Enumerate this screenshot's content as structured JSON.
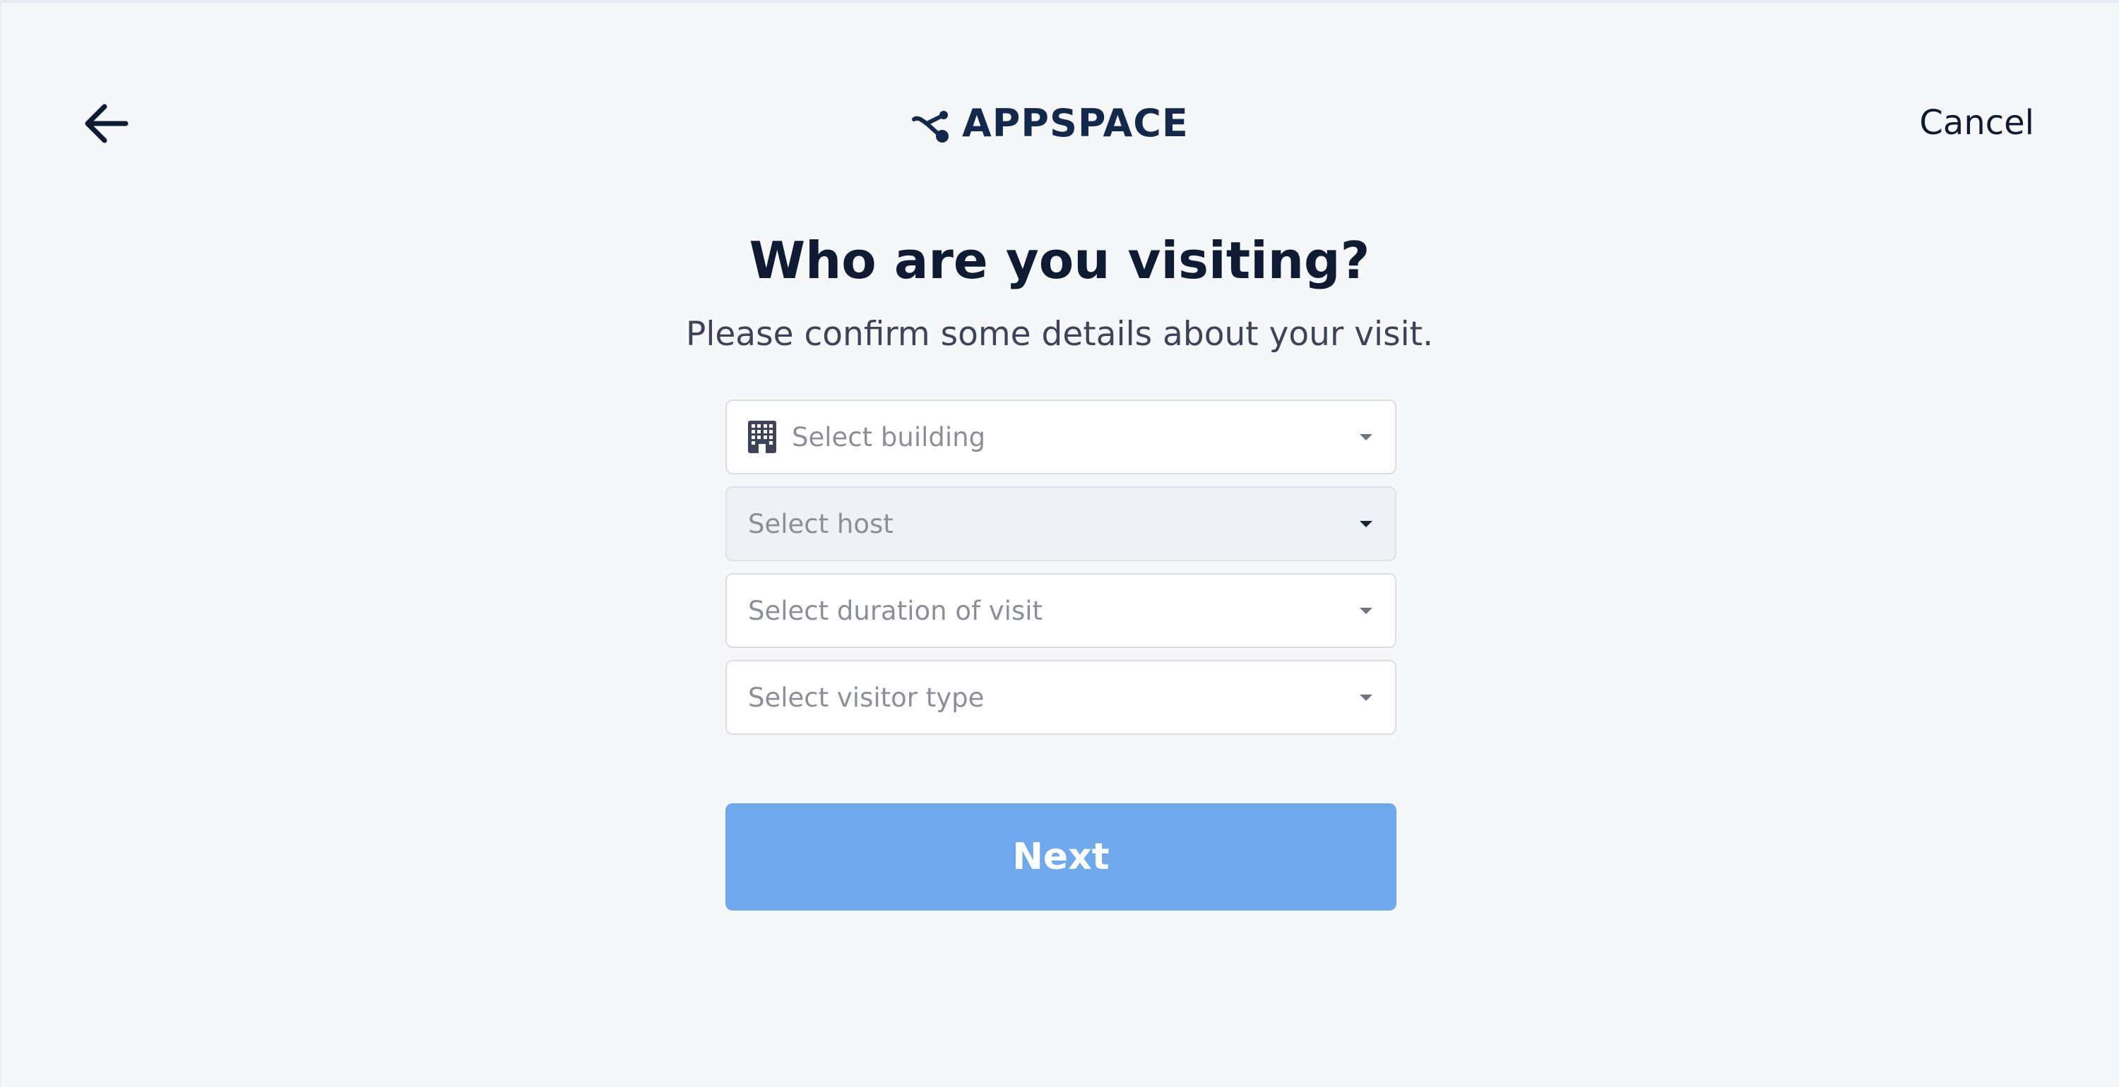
{
  "header": {
    "back_icon": "arrow-left-icon",
    "logo_text": "APPSPACE",
    "cancel_label": "Cancel"
  },
  "main": {
    "title": "Who are you visiting?",
    "subtitle": "Please confirm some details about your visit.",
    "selects": [
      {
        "placeholder": "Select building",
        "icon": "building-icon",
        "disabled": false
      },
      {
        "placeholder": "Select host",
        "disabled": true
      },
      {
        "placeholder": "Select duration of visit",
        "disabled": false
      },
      {
        "placeholder": "Select visitor type",
        "disabled": false
      }
    ],
    "next_label": "Next"
  },
  "colors": {
    "background": "#f6f7f9",
    "text_primary": "#0f1b33",
    "brand": "#13294b",
    "next_button": "#6fa8ec",
    "disabled_field": "#eef2f6"
  }
}
